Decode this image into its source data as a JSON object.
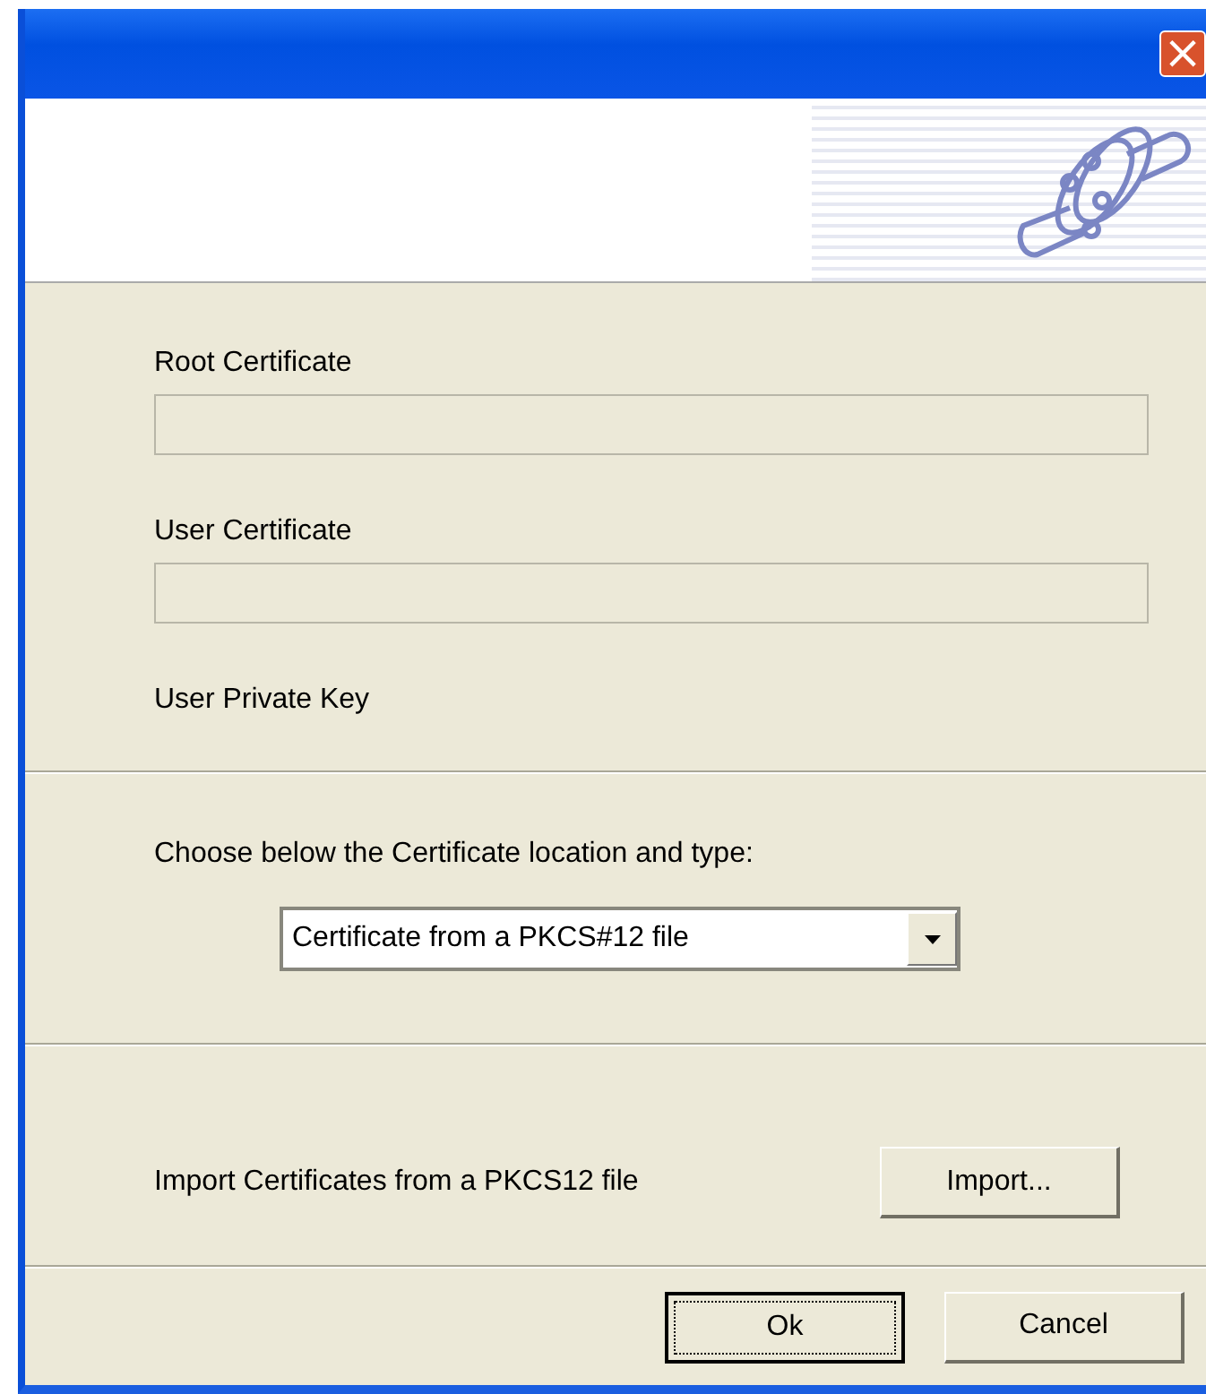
{
  "window": {
    "close_button": "×"
  },
  "fields": [
    {
      "label": "Root Certificate",
      "kind": "field"
    },
    {
      "label": "User Certificate",
      "kind": "field"
    },
    {
      "label": "User Private Key",
      "kind": "label"
    }
  ],
  "location": {
    "prompt": "Choose below the Certificate location and type:",
    "value": "Certificate from a PKCS#12 file"
  },
  "import": {
    "text": "Import Certificates from a PKCS12 file",
    "button": "Import..."
  },
  "buttons": [
    {
      "label": "Ok",
      "focused": true
    },
    {
      "label": "Cancel",
      "focused": false
    }
  ]
}
